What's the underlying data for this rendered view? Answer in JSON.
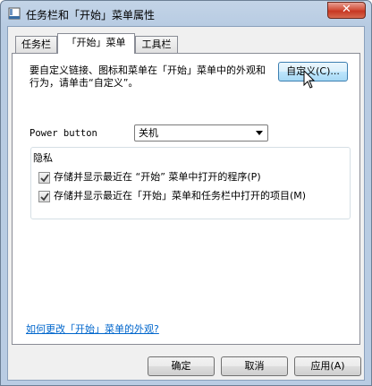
{
  "window": {
    "title": "任务栏和「开始」菜单属性",
    "close_label": "✕"
  },
  "tabs": [
    {
      "label": "任务栏"
    },
    {
      "label": "「开始」菜单"
    },
    {
      "label": "工具栏"
    }
  ],
  "start_menu": {
    "description": "要自定义链接、图标和菜单在「开始」菜单中的外观和行为，请单击“自定义”。",
    "customize_label": "自定义(C)...",
    "power_button_label": "Power button",
    "power_button_value": "关机",
    "privacy": {
      "title": "隐私",
      "items": [
        {
          "label": "存储并显示最近在 “开始” 菜单中打开的程序(P)",
          "checked": true
        },
        {
          "label": "存储并显示最近在「开始」菜单和任务栏中打开的项目(M)",
          "checked": true
        }
      ]
    },
    "help_link": "如何更改「开始」菜单的外观?"
  },
  "buttons": {
    "ok": "确定",
    "cancel": "取消",
    "apply": "应用(A)"
  }
}
